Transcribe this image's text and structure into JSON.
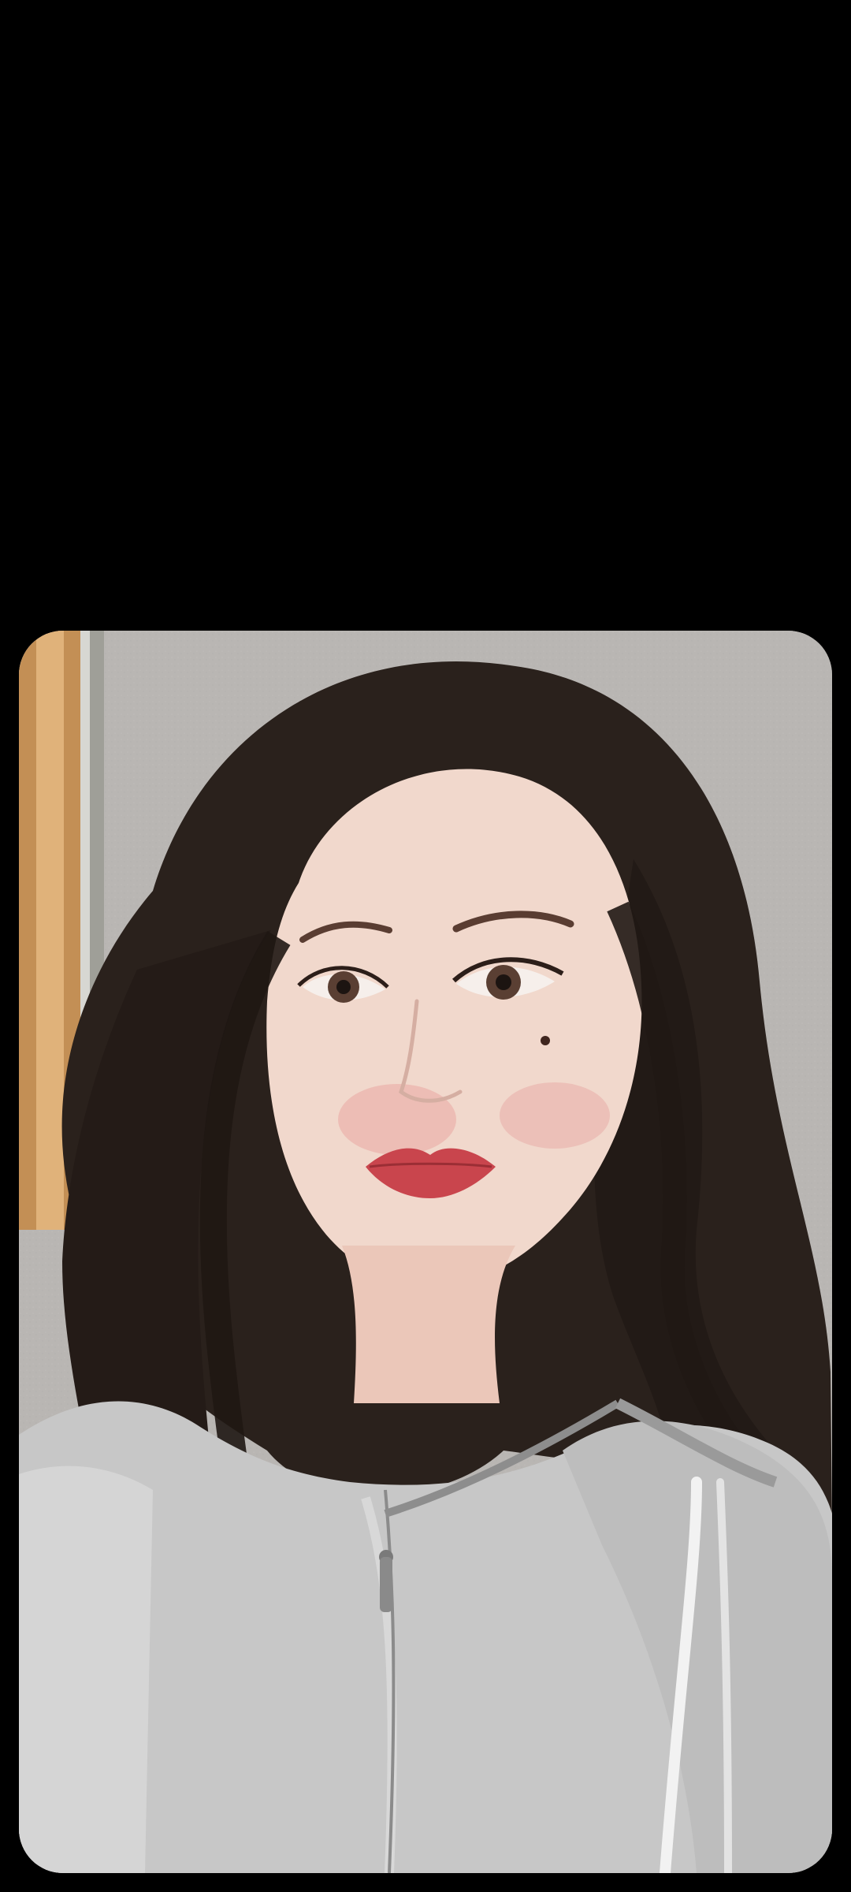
{
  "screen": {
    "background": "#000000"
  },
  "photo": {
    "subject": "portrait-photo",
    "icon": "photo-icon",
    "colors": {
      "wall": "#b9b6b3",
      "door_frame": "#b98a54",
      "hair": "#2a211c",
      "skin": "#f1d8cc",
      "lips": "#c9454d",
      "hoodie": "#c7c7c7",
      "drawstring": "#f2f2f2"
    }
  }
}
